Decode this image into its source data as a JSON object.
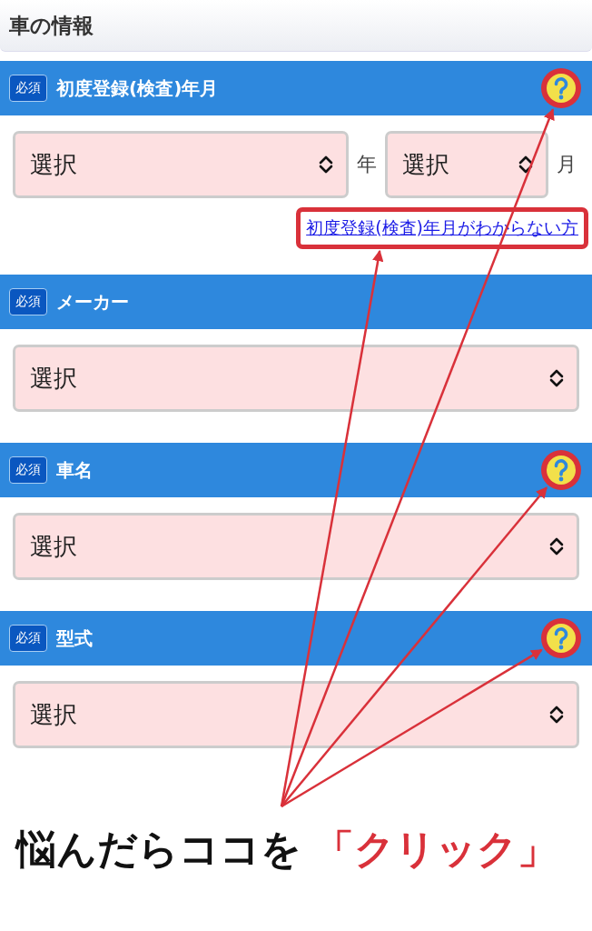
{
  "header": {
    "title": "車の情報"
  },
  "sections": [
    {
      "badge": "必須",
      "label": "初度登録(検査)年月",
      "help": true,
      "fields": [
        {
          "kind": "select",
          "value": "選択",
          "unit": "年"
        },
        {
          "kind": "select",
          "value": "選択",
          "unit": "月"
        }
      ],
      "link": {
        "text": "初度登録(検査)年月がわからない方",
        "highlighted": true
      }
    },
    {
      "badge": "必須",
      "label": "メーカー",
      "help": false,
      "fields": [
        {
          "kind": "select",
          "value": "選択"
        }
      ]
    },
    {
      "badge": "必須",
      "label": "車名",
      "help": true,
      "fields": [
        {
          "kind": "select",
          "value": "選択"
        }
      ]
    },
    {
      "badge": "必須",
      "label": "型式",
      "help": true,
      "fields": [
        {
          "kind": "select",
          "value": "選択"
        }
      ]
    }
  ],
  "caption": {
    "text": "悩んだらココを",
    "emphasis": "「クリック」"
  }
}
